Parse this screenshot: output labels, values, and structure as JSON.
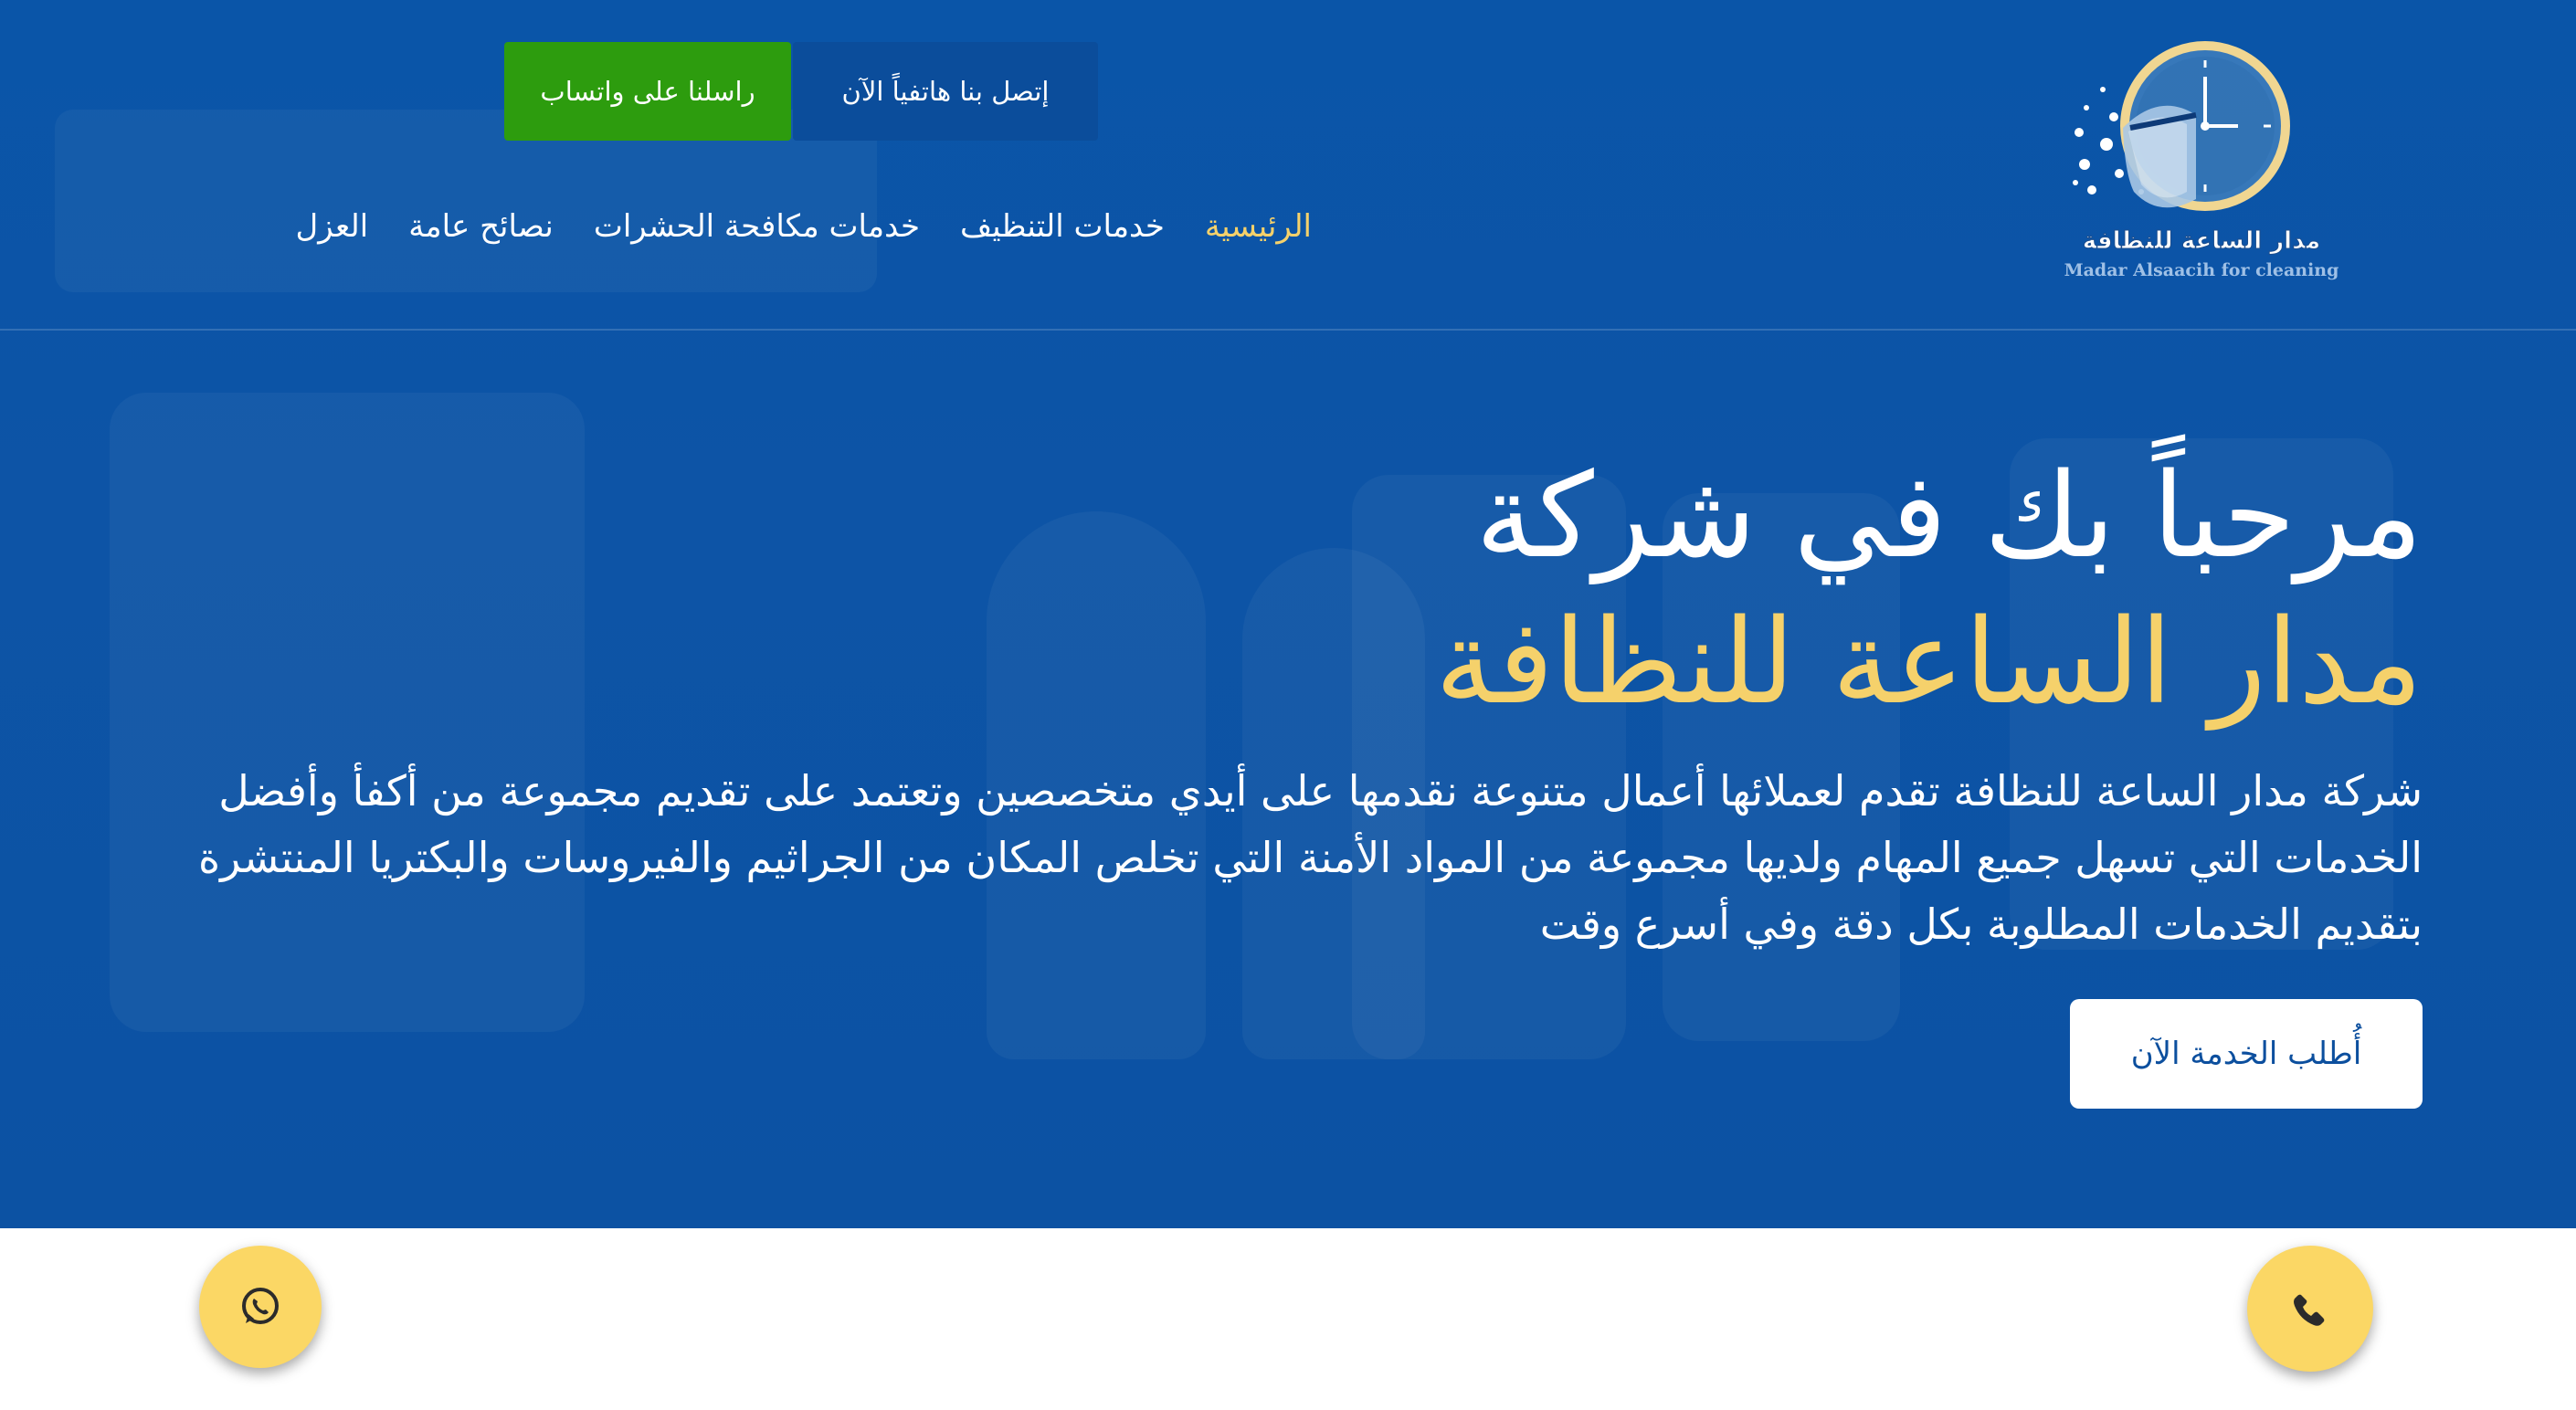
{
  "brand": {
    "logo_text_ar": "مدار الساعة للنظافة",
    "logo_text_en": "Madar Alsaacih for cleaning"
  },
  "header": {
    "call_button": "إتصل بنا هاتفياً الآن",
    "whatsapp_button": "راسلنا على واتساب"
  },
  "nav": {
    "items": [
      {
        "label": "الرئيسية",
        "active": true
      },
      {
        "label": "خدمات التنظيف",
        "active": false
      },
      {
        "label": "خدمات مكافحة الحشرات",
        "active": false
      },
      {
        "label": "نصائح عامة",
        "active": false
      },
      {
        "label": "العزل",
        "active": false
      }
    ]
  },
  "hero": {
    "title_line1": "مرحباً بك في شركة",
    "title_line2": "مدار الساعة للنظافة",
    "description": "شركة مدار الساعة للنظافة تقدم لعملائها أعمال متنوعة نقدمها على أيدي متخصصين وتعتمد على تقديم مجموعة من أكفأ وأفضل الخدمات التي تسهل جميع المهام ولديها مجموعة من المواد الأمنة التي تخلص المكان من الجراثيم والفيروسات والبكتريا المنتشرة بتقديم الخدمات المطلوبة بكل دقة وفي أسرع وقت",
    "cta_button": "أُطلب الخدمة الآن"
  },
  "floating": {
    "whatsapp_icon": "whatsapp-icon",
    "phone_icon": "phone-icon"
  },
  "colors": {
    "hero_blue": "#0c52a3",
    "accent_yellow": "#f5d16b",
    "whatsapp_green": "#2d9c0e",
    "fab_yellow": "#fbd765"
  }
}
